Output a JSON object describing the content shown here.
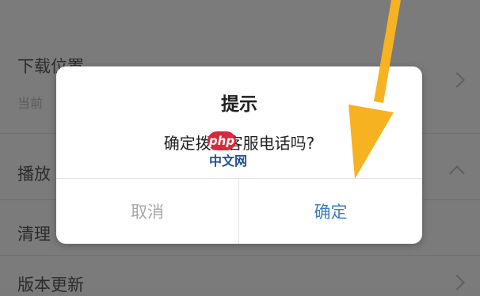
{
  "settings": {
    "download_location": "下载位置",
    "download_path": "当前",
    "playback": "播放",
    "cleanup": "清理",
    "version_update": "版本更新"
  },
  "dialog": {
    "title": "提示",
    "message": "确定拨打客服电话吗?",
    "cancel_label": "取消",
    "confirm_label": "确定"
  },
  "watermark": {
    "badge": "php",
    "text": "中文网"
  },
  "colors": {
    "overlay_bg": "#7b7b7b",
    "confirm": "#3a7fc0",
    "cancel": "#a9a9a9",
    "arrow": "#f6b221"
  }
}
